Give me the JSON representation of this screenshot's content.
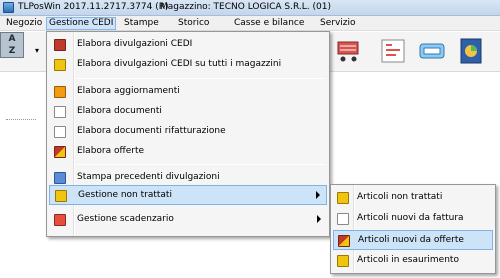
{
  "window": {
    "title": "TLPosWin 2017.11.2717.3774 (R)",
    "magazzino": "Magazzino: TECNO LOGICA S.R.L. (01)"
  },
  "menubar": {
    "items": [
      {
        "label": "Negozio",
        "name": "menu-negozio"
      },
      {
        "label": "Gestione CEDI",
        "name": "menu-gestione-cedi"
      },
      {
        "label": "Stampe",
        "name": "menu-stampe"
      },
      {
        "label": "Storico",
        "name": "menu-storico"
      },
      {
        "label": "Casse e bilance",
        "name": "menu-casse-e-bilance"
      },
      {
        "label": "Servizio",
        "name": "menu-servizio"
      }
    ]
  },
  "toolbar": {
    "sort_label": "A\nZ"
  },
  "gestione_cedi_menu": {
    "items": [
      {
        "label": "Elabora divulgazioni CEDI",
        "icon": "cedi-elabora-icon",
        "color": "#c0392b"
      },
      {
        "label": "Elabora divulgazioni CEDI su tutti i magazzini",
        "icon": "folder-icon",
        "color": "#f1c40f"
      },
      {
        "label": "Elabora aggiornamenti",
        "icon": "update-icon",
        "color": "#f39c12"
      },
      {
        "label": "Elabora documenti",
        "icon": "document-icon",
        "color": "#dcdcdc"
      },
      {
        "label": "Elabora documenti rifatturazione",
        "icon": "document-icon",
        "color": "#dcdcdc"
      },
      {
        "label": "Elabora offerte",
        "icon": "offers-icon",
        "color": "#c0392b"
      },
      {
        "label": "Stampa precedenti divulgazioni",
        "icon": "print-icon",
        "color": "#5b8dd6"
      },
      {
        "label": "Gestione non trattati",
        "icon": "non-trattati-icon",
        "color": "#f1c40f"
      },
      {
        "label": "Gestione scadenzario",
        "icon": "scadenzario-icon",
        "color": "#e74c3c"
      }
    ]
  },
  "submenu_non_trattati": {
    "items": [
      {
        "label": "Articoli non trattati",
        "icon": "articles-icon",
        "color": "#f1c40f"
      },
      {
        "label": "Articoli nuovi da fattura",
        "icon": "invoice-icon",
        "color": "#dcdcdc"
      },
      {
        "label": "Articoli nuovi da offerte",
        "icon": "offers-icon",
        "color": "#c0392b"
      },
      {
        "label": "Articoli in esaurimento",
        "icon": "exhaust-icon",
        "color": "#f1c40f"
      }
    ]
  }
}
